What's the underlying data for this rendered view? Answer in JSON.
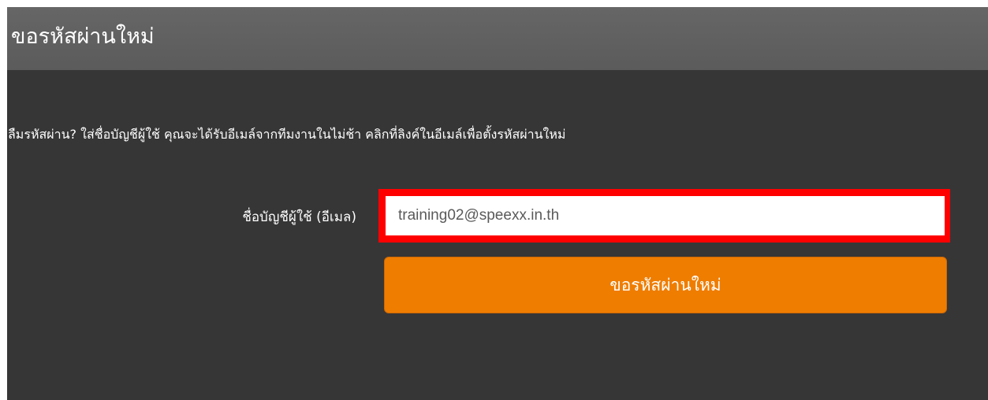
{
  "header": {
    "title": "ขอรหัสผ่านใหม่"
  },
  "description": "ลืมรหัสผ่าน? ใส่ชื่อบัญชีผู้ใช้ คุณจะได้รับอีเมล์จากทีมงานในไม่ช้า คลิกที่ลิงค์ในอีเมล์เพื่อตั้งรหัสผ่านใหม่",
  "form": {
    "username_label": "ชื่อบัญชีผู้ใช้ (อีเมล)",
    "username_value": "training02@speexx.in.th",
    "submit_label": "ขอรหัสผ่านใหม่"
  },
  "colors": {
    "panel_background": "#363636",
    "header_background": "#5f5f5f",
    "button_accent": "#ef7d00",
    "highlight_border": "#ff0000"
  }
}
